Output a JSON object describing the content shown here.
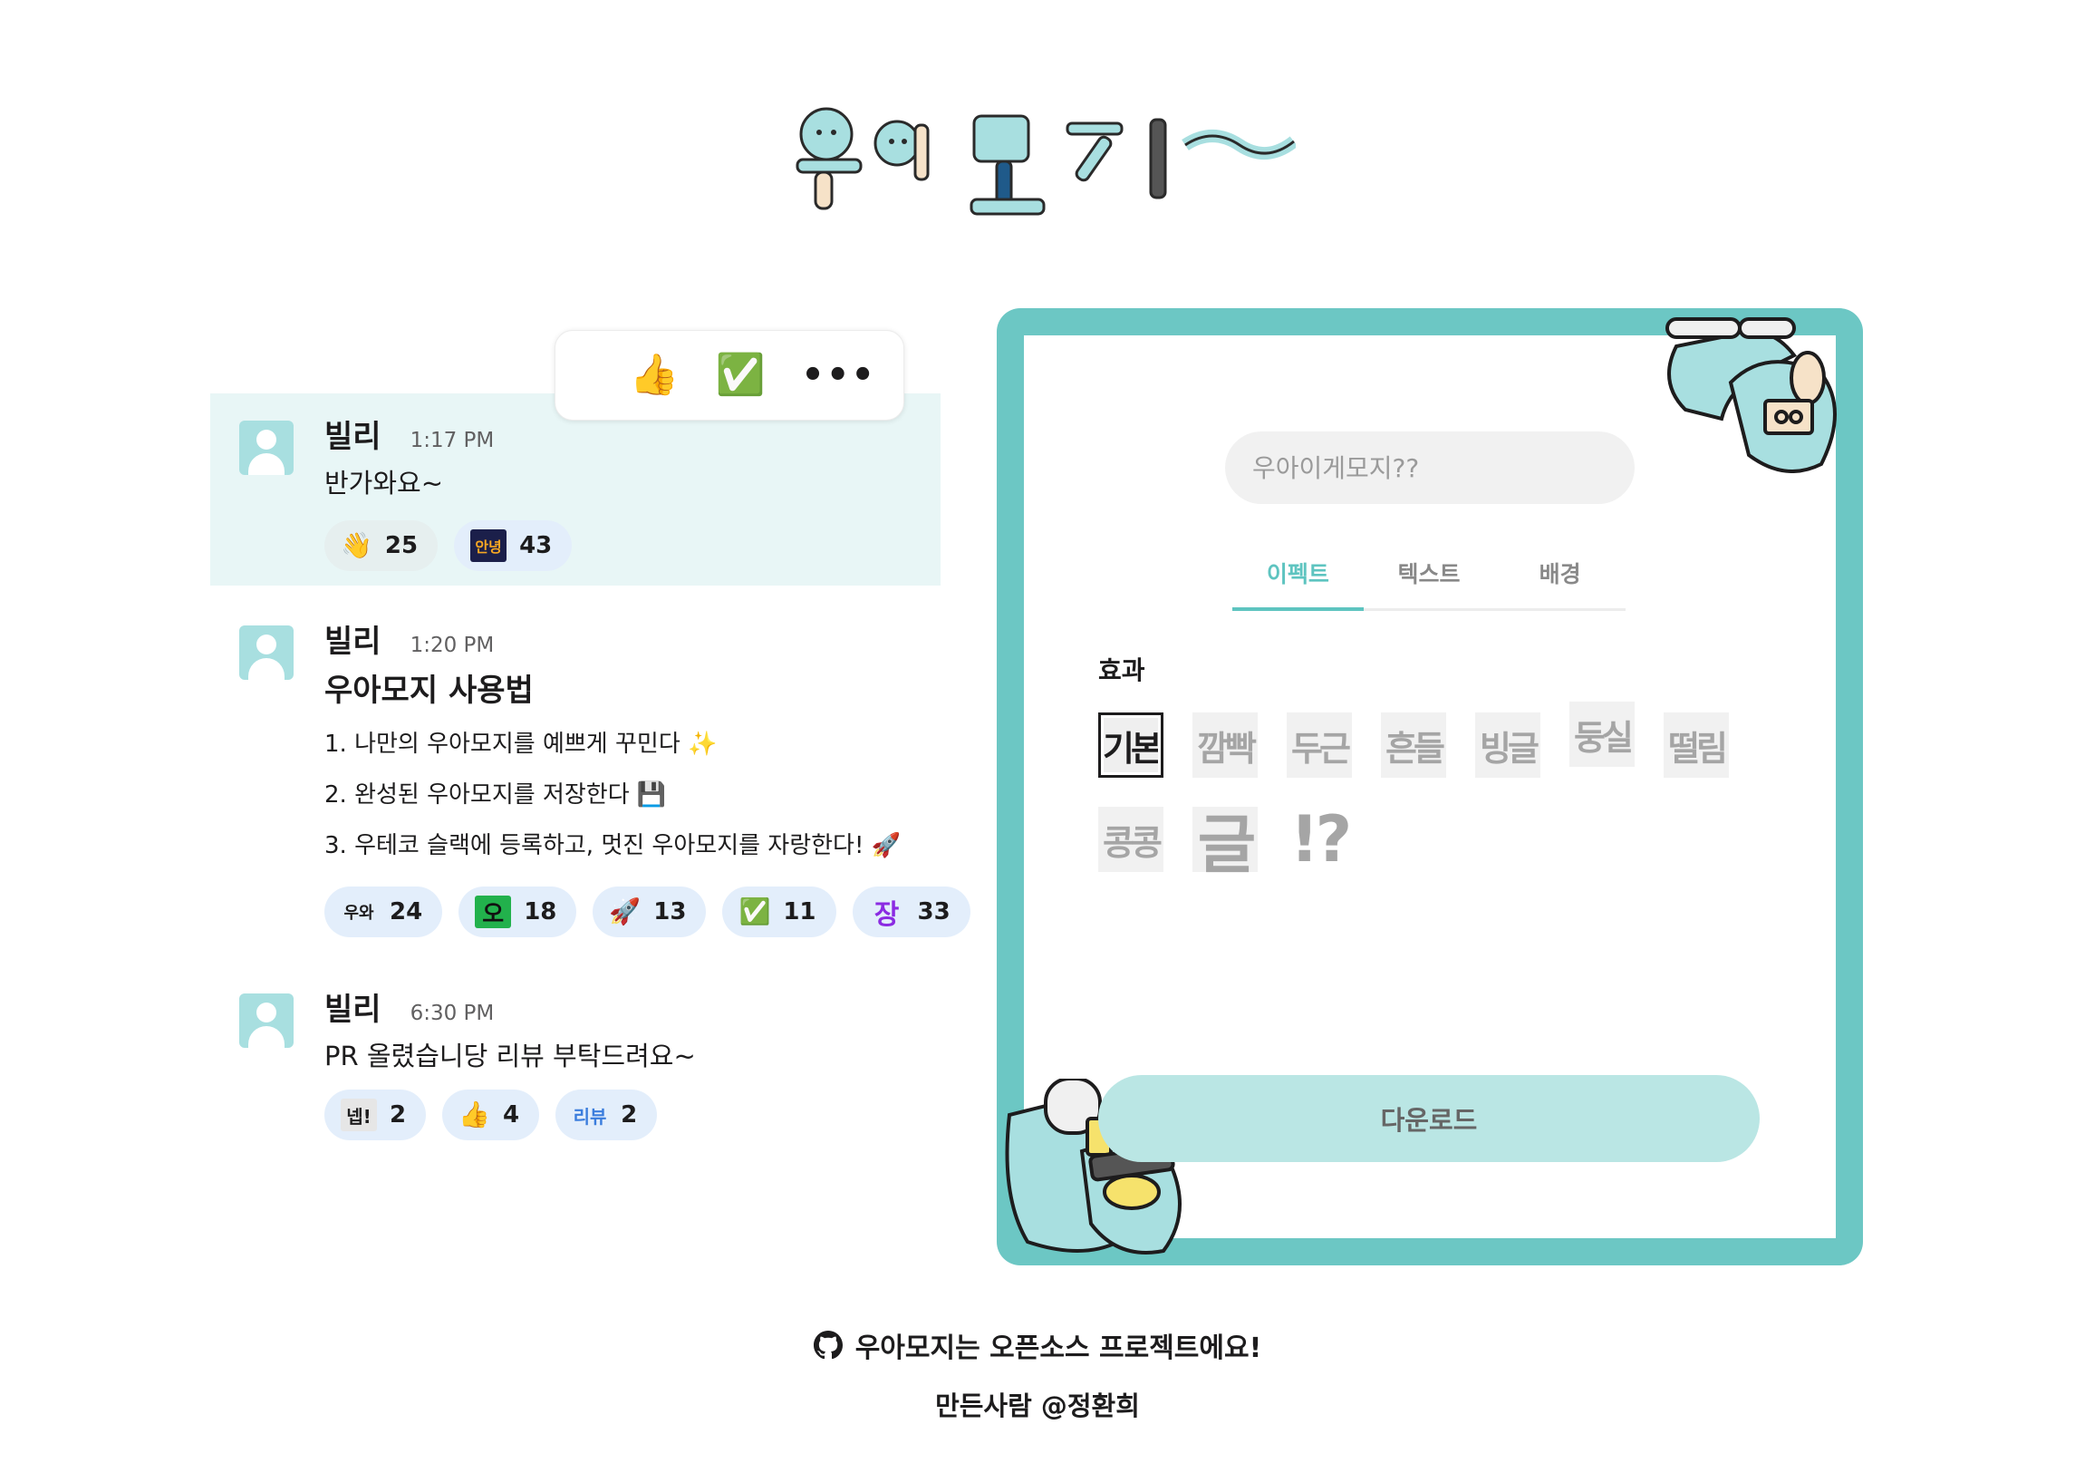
{
  "logo": {
    "alt_text": "우아모지~"
  },
  "colors": {
    "brand": "#6cc7c4",
    "tab_active": "#5ec4c0",
    "download_button": "#bae6e4",
    "highlight_row": "#e8f6f6"
  },
  "toolbar": {
    "thumbs_up": "👍",
    "check": "✅",
    "more": "•••"
  },
  "messages": [
    {
      "name": "빌리",
      "time": "1:17 PM",
      "text": "반가와요~",
      "reactions": [
        {
          "emoji": "👋",
          "count": "25"
        },
        {
          "emoji": "안녕",
          "count": "43"
        }
      ]
    },
    {
      "name": "빌리",
      "time": "1:20 PM",
      "title": "우아모지 사용법",
      "lines": [
        "1. 나만의 우아모지를 예쁘게 꾸민다 ✨",
        "2. 완성된 우아모지를 저장한다 💾",
        "3. 우테코 슬랙에 등록하고, 멋진 우아모지를 자랑한다! 🚀"
      ],
      "reactions": [
        {
          "emoji": "우와",
          "count": "24"
        },
        {
          "emoji": "오",
          "count": "18"
        },
        {
          "emoji": "🚀",
          "count": "13"
        },
        {
          "emoji": "✅",
          "count": "11"
        },
        {
          "emoji": "장",
          "count": "33"
        }
      ]
    },
    {
      "name": "빌리",
      "time": "6:30 PM",
      "text": "PR 올렸습니당 리뷰 부탁드려요~",
      "reactions": [
        {
          "emoji": "넵!",
          "count": "2"
        },
        {
          "emoji": "👍",
          "count": "4"
        },
        {
          "emoji": "리뷰",
          "count": "2"
        }
      ]
    }
  ],
  "editor": {
    "search_placeholder": "우아이게모지??",
    "tabs": [
      "이펙트",
      "텍스트",
      "배경"
    ],
    "active_tab": "이펙트",
    "section_label": "효과",
    "effects": [
      "기본",
      "깜빡",
      "두근",
      "흔들",
      "빙글",
      "둥실",
      "떨림",
      "콩콩",
      "글",
      "!?"
    ],
    "selected_effect": "기본",
    "download_label": "다운로드"
  },
  "footer": {
    "github_icon": "github-icon",
    "open_source_text": "우아모지는 오픈소스 프로젝트에요!",
    "author_text": "만든사람 @정환희"
  }
}
